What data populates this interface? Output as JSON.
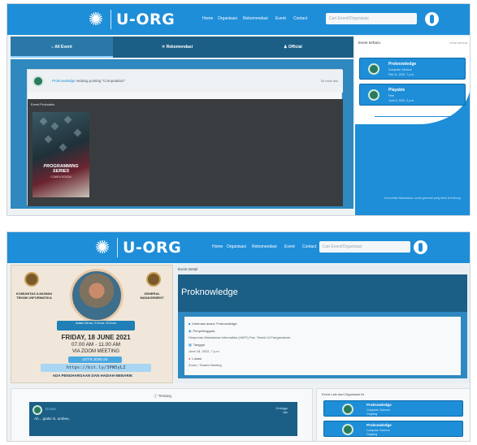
{
  "navbar": {
    "brand": "U-ORG",
    "links": [
      "Home",
      "Organisasi",
      "Rekomendasi",
      "Event",
      "Contact"
    ],
    "search_placeholder": "Cari Event/Organisasi"
  },
  "feed_page": {
    "tabs": [
      "All Event",
      "Rekomendasi",
      "Official"
    ],
    "post": {
      "org": "Proknowledge",
      "text": "sedang posting \"Computation\"",
      "time": "30 minit lalu",
      "caption": "Event Prokodelu",
      "poster_title": "PROGRAMMING SERIES",
      "poster_subtitle": "COMPUTATION"
    },
    "sidebar": {
      "title": "Event terbaru",
      "link": "Lihat semua",
      "events": [
        {
          "title": "Proknowledge",
          "org": "Computer Science",
          "date": "Feb 11, 2022, 7 p.m."
        },
        {
          "title": "Playable",
          "org": "Free",
          "date": "June 8, 2022, 3 p.m."
        }
      ],
      "footer": "Komunitas Mahasiswa, untuk generasi yang lebih terhubung"
    }
  },
  "detail_page": {
    "breadcrumb": "Event Detail",
    "title": "Proknowledge",
    "info": [
      {
        "label": "Informasi acara: Proknowledge",
        "icon": "info-icon"
      },
      {
        "label": "Penyelenggara",
        "icon": "users-icon"
      },
      {
        "label": "Himpunan Mahasiswa Informatika (HMTI) Fak. Teknik UI Pangandaran",
        "icon": ""
      },
      {
        "label": "Tanggal",
        "icon": "calendar-icon"
      },
      {
        "label": "June 18, 2022, 7 p.m.",
        "icon": ""
      },
      {
        "label": "Lokasi",
        "icon": "pin-icon"
      },
      {
        "label": "Zoom / Teams Meeting",
        "icon": ""
      }
    ],
    "poster": {
      "left_text": "KOMUNITAS ILMUWAN TEKNIK INFORMATIKA",
      "right_text": "GENERAL MANAGEMENT",
      "speaker": "Adam Dinar, S.Kom, M.Kom",
      "date": "FRIDAY, 18 JUNE 2021",
      "time": "07.00 AM - 11.00 AM",
      "place": "VIA ZOOM MEETING",
      "join": "LET'S JOIN US",
      "link": "https://bit.ly/3PW5yLZ",
      "bottom": "ADA PENGHARGAAN DAN HADIAH MENARIK"
    },
    "about": {
      "heading": "Tentang",
      "org": "Dosen",
      "dates": [
        "8 minggu",
        "lalu"
      ],
      "text": "Ah... gratis ni, ambeu."
    },
    "others": {
      "title": "Event Lain dari Organisasi Ini",
      "events": [
        {
          "title": "Proknowledge",
          "sub1": "Computer Science",
          "sub2": "Ongoing"
        },
        {
          "title": "Proknowledge",
          "sub1": "Computer Science",
          "sub2": "Ongoing"
        }
      ]
    }
  },
  "colors": {
    "nav_blue": "#1e8ed8",
    "dark_teal": "#1c5f86",
    "mid_blue": "#2f88bf"
  }
}
